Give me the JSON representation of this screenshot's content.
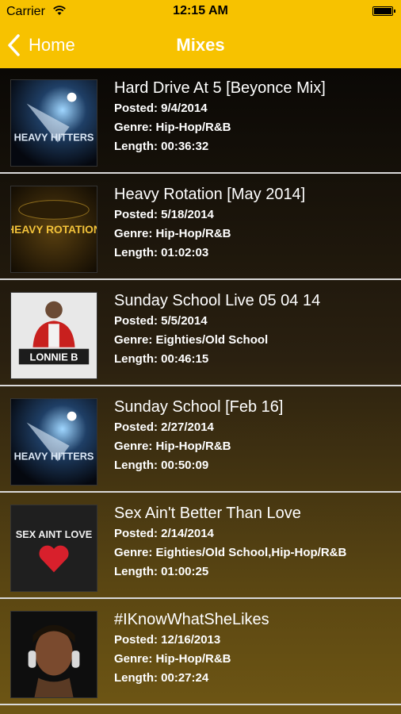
{
  "status": {
    "carrier": "Carrier",
    "time": "12:15 AM"
  },
  "nav": {
    "back_label": "Home",
    "title": "Mixes"
  },
  "mixes": [
    {
      "title": "Hard Drive At 5 [Beyonce Mix]",
      "posted": "Posted: 9/4/2014",
      "genre": "Genre: Hip-Hop/R&B",
      "length": "Length: 00:36:32",
      "art": "HEAVY HITTERS"
    },
    {
      "title": "Heavy Rotation [May 2014]",
      "posted": "Posted: 5/18/2014",
      "genre": "Genre: Hip-Hop/R&B",
      "length": "Length: 01:02:03",
      "art": "HEAVY ROTATION"
    },
    {
      "title": "Sunday School Live 05 04 14",
      "posted": "Posted: 5/5/2014",
      "genre": "Genre: Eighties/Old School",
      "length": "Length: 00:46:15",
      "art": "LONNIE B"
    },
    {
      "title": "Sunday School [Feb 16]",
      "posted": "Posted: 2/27/2014",
      "genre": "Genre: Hip-Hop/R&B",
      "length": "Length: 00:50:09",
      "art": "HEAVY HITTERS"
    },
    {
      "title": "Sex Ain't Better Than Love",
      "posted": "Posted: 2/14/2014",
      "genre": "Genre: Eighties/Old School,Hip-Hop/R&B",
      "length": "Length: 01:00:25",
      "art": "SEX AINT LOVE"
    },
    {
      "title": "#IKnowWhatSheLikes",
      "posted": "Posted: 12/16/2013",
      "genre": "Genre: Hip-Hop/R&B",
      "length": "Length: 00:27:24",
      "art": ""
    }
  ]
}
